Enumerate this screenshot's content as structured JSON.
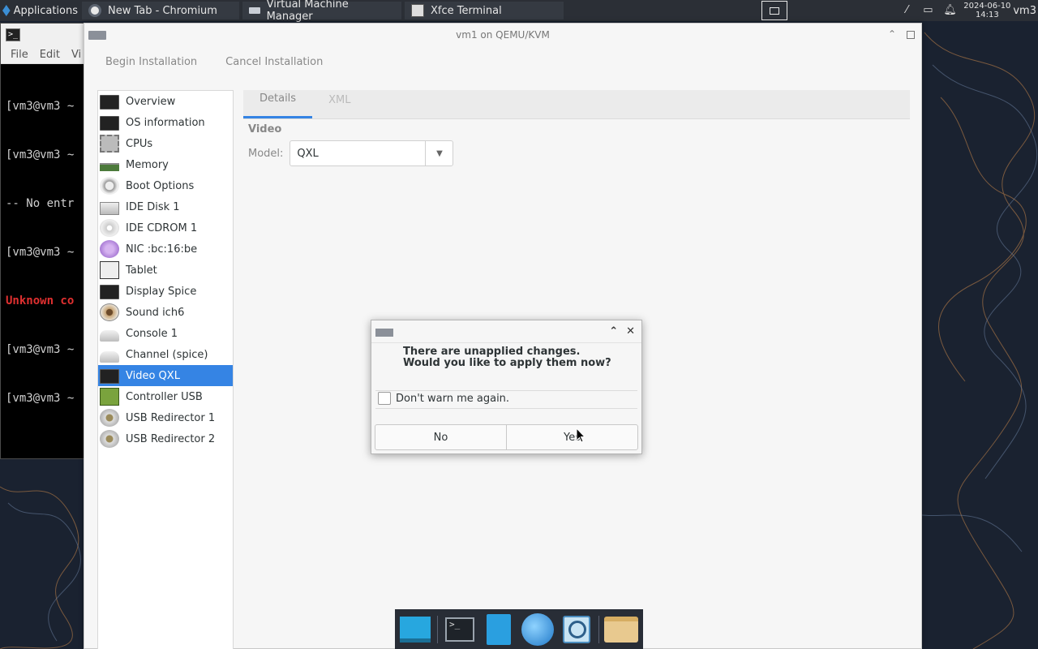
{
  "panel": {
    "applications_label": "Applications",
    "tasks": [
      {
        "label": "New Tab - Chromium"
      },
      {
        "label": "Virtual Machine Manager"
      },
      {
        "label": "Xfce Terminal"
      }
    ],
    "date": "2024-06-10",
    "time": "14:13",
    "user": "vm3"
  },
  "terminal": {
    "menu": [
      "File",
      "Edit",
      "Vi"
    ],
    "lines": [
      {
        "text": "[vm3@vm3 ~",
        "style": "normal"
      },
      {
        "text": "[vm3@vm3 ~",
        "style": "normal"
      },
      {
        "text": "-- No entr",
        "style": "normal"
      },
      {
        "text": "[vm3@vm3 ~",
        "style": "normal"
      },
      {
        "text": "Unknown co",
        "style": "red"
      },
      {
        "text": "[vm3@vm3 ~",
        "style": "normal"
      },
      {
        "text": "[vm3@vm3 ~",
        "style": "normal"
      }
    ]
  },
  "vm_window": {
    "title": "vm1 on QEMU/KVM",
    "toolbar": {
      "begin_label": "Begin Installation",
      "cancel_label": "Cancel Installation"
    },
    "sidebar_items": [
      {
        "label": "Overview",
        "icon": "monitor-icon"
      },
      {
        "label": "OS information",
        "icon": "monitor-icon"
      },
      {
        "label": "CPUs",
        "icon": "cpu-icon"
      },
      {
        "label": "Memory",
        "icon": "memory-icon"
      },
      {
        "label": "Boot Options",
        "icon": "gears-icon"
      },
      {
        "label": "IDE Disk 1",
        "icon": "disk-icon"
      },
      {
        "label": "IDE CDROM 1",
        "icon": "cdrom-icon"
      },
      {
        "label": "NIC :bc:16:be",
        "icon": "nic-icon"
      },
      {
        "label": "Tablet",
        "icon": "tablet-icon"
      },
      {
        "label": "Display Spice",
        "icon": "monitor-icon"
      },
      {
        "label": "Sound ich6",
        "icon": "speaker-icon"
      },
      {
        "label": "Console 1",
        "icon": "console-icon"
      },
      {
        "label": "Channel (spice)",
        "icon": "console-icon"
      },
      {
        "label": "Video QXL",
        "icon": "monitor-icon",
        "selected": true
      },
      {
        "label": "Controller USB",
        "icon": "controller-icon"
      },
      {
        "label": "USB Redirector 1",
        "icon": "usb-icon"
      },
      {
        "label": "USB Redirector 2",
        "icon": "usb-icon"
      }
    ],
    "tabs": [
      {
        "label": "Details",
        "active": true
      },
      {
        "label": "XML",
        "active": false
      }
    ],
    "section_title": "Video",
    "model_label": "Model:",
    "model_value": "QXL"
  },
  "dialog": {
    "message": "There are unapplied changes. Would you like to apply them now?",
    "checkbox_label": "Don't warn me again.",
    "checkbox_checked": false,
    "no_label": "No",
    "yes_label": "Yes"
  },
  "dock": {
    "items": [
      "desktop-icon",
      "terminal-icon",
      "files-icon",
      "web-browser-icon",
      "search-icon",
      "folder-icon"
    ]
  },
  "colors": {
    "selection": "#3584e4",
    "panel_bg": "#2b2f36",
    "wallpaper": "#1a2230"
  }
}
